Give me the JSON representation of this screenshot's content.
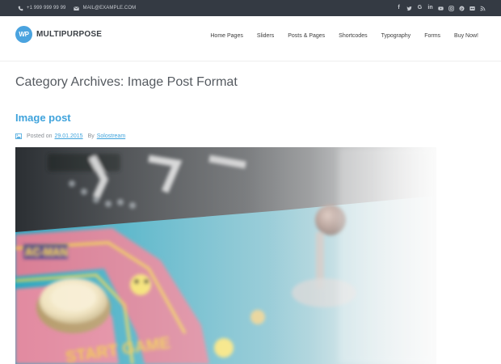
{
  "topbar": {
    "phone": "+1 999 999 99 99",
    "email": "MAIL@EXAMPLE.COM",
    "social_icons": [
      "facebook-icon",
      "twitter-icon",
      "google-icon",
      "linkedin-icon",
      "youtube-icon",
      "instagram-icon",
      "pinterest-icon",
      "flickr-icon",
      "rss-icon"
    ],
    "background": "#343a43"
  },
  "header": {
    "logo_badge": "WP",
    "logo_text": "MULTIPURPOSE",
    "nav": [
      "Home Pages",
      "Sliders",
      "Posts & Pages",
      "Shortcodes",
      "Typography",
      "Forms",
      "Buy Now!"
    ]
  },
  "main": {
    "page_title": "Category Archives: Image Post Format",
    "post": {
      "title": "Image post",
      "posted_on_label": "Posted on",
      "date": "29.01.2015",
      "by_label": "By",
      "author": "Solostream",
      "format_icon": "image-icon",
      "featured_image": "arcade-machine-joystick-photo"
    }
  },
  "colors": {
    "accent": "#3fa3dc",
    "logo_badge": "#4aa3df"
  }
}
